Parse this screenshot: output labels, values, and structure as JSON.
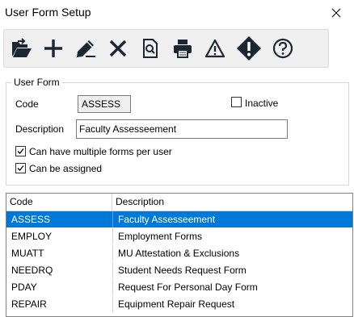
{
  "window": {
    "title": "User Form Setup"
  },
  "toolbar": {
    "buttons": [
      {
        "name": "open-button",
        "icon": "open-folder-icon"
      },
      {
        "name": "add-button",
        "icon": "plus-icon"
      },
      {
        "name": "edit-button",
        "icon": "pencil-icon"
      },
      {
        "name": "delete-button",
        "icon": "x-icon"
      },
      {
        "name": "preview-button",
        "icon": "magnify-document-icon"
      },
      {
        "name": "print-button",
        "icon": "printer-icon"
      },
      {
        "name": "warning-button",
        "icon": "warning-triangle-icon"
      },
      {
        "name": "alert-button",
        "icon": "diamond-exclamation-icon"
      },
      {
        "name": "help-button",
        "icon": "question-circle-icon"
      }
    ],
    "icon_color": "#1a2733"
  },
  "form": {
    "group_label": "User Form",
    "code_label": "Code",
    "code_value": "ASSESS",
    "inactive_label": "Inactive",
    "inactive_checked": false,
    "description_label": "Description",
    "description_value": "Faculty Assesseement",
    "multiple_label": "Can have multiple forms per user",
    "multiple_checked": true,
    "assigned_label": "Can be assigned",
    "assigned_checked": true
  },
  "grid": {
    "columns": [
      "Code",
      "Description"
    ],
    "rows": [
      {
        "code": "ASSESS",
        "description": "Faculty Assesseement",
        "selected": true
      },
      {
        "code": "EMPLOY",
        "description": "Employment Forms",
        "selected": false
      },
      {
        "code": "MUATT",
        "description": "MU Attestation & Exclusions",
        "selected": false
      },
      {
        "code": "NEEDRQ",
        "description": "Student Needs Request Form",
        "selected": false
      },
      {
        "code": "PDAY",
        "description": "Request For Personal Day Form",
        "selected": false
      },
      {
        "code": "REPAIR",
        "description": "Equipment Repair Request",
        "selected": false
      }
    ],
    "selection_color": "#0078d7"
  }
}
